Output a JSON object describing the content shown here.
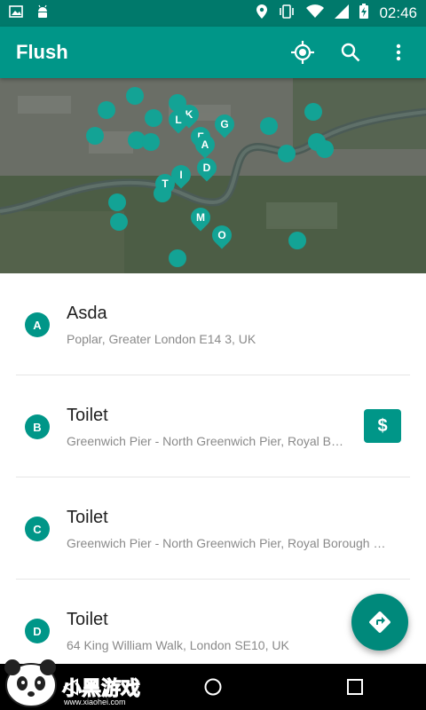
{
  "status": {
    "time": "02:46"
  },
  "appbar": {
    "title": "Flush",
    "icons": [
      "my-location-icon",
      "search-icon",
      "more-vert-icon"
    ]
  },
  "map": {
    "labeled_markers": [
      "K",
      "L",
      "G",
      "F",
      "A",
      "D",
      "T",
      "I",
      "M",
      "O"
    ]
  },
  "list": [
    {
      "badge": "A",
      "title": "Asda",
      "address": "Poplar, Greater London E14 3, UK",
      "paid": false
    },
    {
      "badge": "B",
      "title": "Toilet",
      "address": "Greenwich Pier - North Greenwich Pier, Royal Borough of Greenwich",
      "paid": true,
      "paid_symbol": "$"
    },
    {
      "badge": "C",
      "title": "Toilet",
      "address": "Greenwich Pier - North Greenwich Pier, Royal Borough of Greenwich",
      "paid": false
    },
    {
      "badge": "D",
      "title": "Toilet",
      "address": "64 King William Walk, London SE10, UK",
      "paid": false
    }
  ],
  "fab": {
    "icon": "directions-icon"
  },
  "watermark": {
    "text": "小黑游戏",
    "url": "www.xiaohei.com"
  },
  "colors": {
    "primary": "#009688",
    "primary_dark": "#00796b",
    "fab": "#00897b"
  }
}
